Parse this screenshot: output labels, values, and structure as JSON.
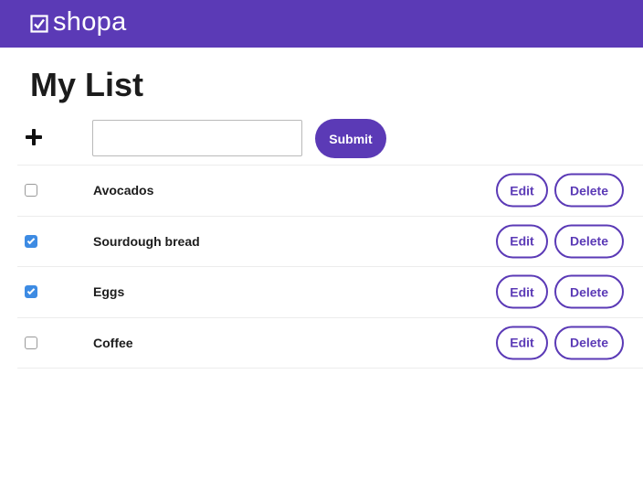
{
  "app": {
    "name": "shopa",
    "logo_icon": "checkbox-icon"
  },
  "colors": {
    "brand": "#5b3ab6",
    "checkbox_checked": "#3d8be3"
  },
  "page": {
    "title": "My List"
  },
  "add_form": {
    "add_icon": "plus-icon",
    "input_value": "",
    "submit_label": "Submit"
  },
  "list": {
    "items": [
      {
        "label": "Avocados",
        "checked": false,
        "edit_label": "Edit",
        "delete_label": "Delete"
      },
      {
        "label": "Sourdough bread",
        "checked": true,
        "edit_label": "Edit",
        "delete_label": "Delete"
      },
      {
        "label": "Eggs",
        "checked": true,
        "edit_label": "Edit",
        "delete_label": "Delete"
      },
      {
        "label": "Coffee",
        "checked": false,
        "edit_label": "Edit",
        "delete_label": "Delete"
      }
    ]
  }
}
